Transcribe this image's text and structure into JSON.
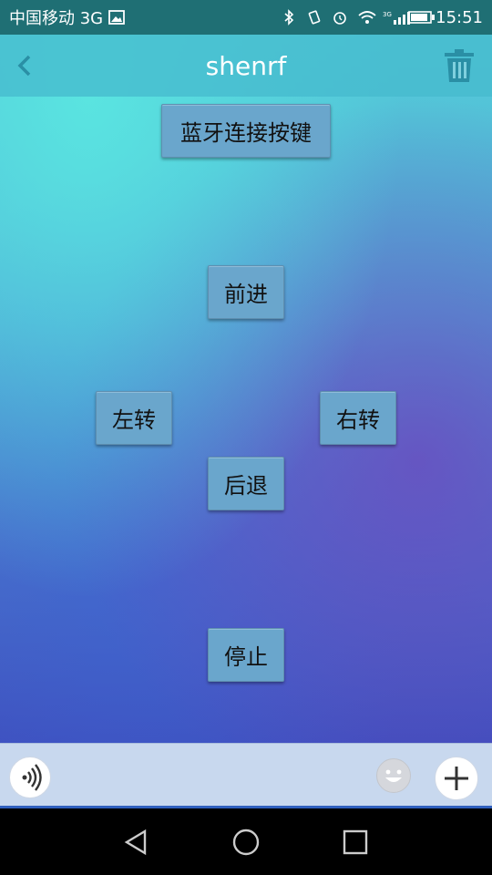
{
  "status_bar": {
    "carrier": "中国移动 3G",
    "time": "15:51",
    "icons": [
      "image-icon",
      "bluetooth-icon",
      "vibrate-icon",
      "alarm-icon",
      "wifi-icon",
      "signal-icon",
      "battery-icon"
    ]
  },
  "app_bar": {
    "title": "shenrf",
    "back_icon": "chevron-left-icon",
    "trash_icon": "trash-icon"
  },
  "controls": {
    "bluetooth_connect": "蓝牙连接按键",
    "forward": "前进",
    "left": "左转",
    "right": "右转",
    "backward": "后退",
    "stop": "停止"
  },
  "input_bar": {
    "voice_icon": "voice-icon",
    "emoji_icon": "emoji-icon",
    "plus_icon": "plus-icon"
  },
  "nav_bar": {
    "icons": [
      "back-triangle-icon",
      "home-circle-icon",
      "recents-square-icon"
    ]
  },
  "colors": {
    "app_bar": "#46b9cd",
    "button": "#6aa6cc",
    "accent_blue": "#2f5fbd"
  }
}
